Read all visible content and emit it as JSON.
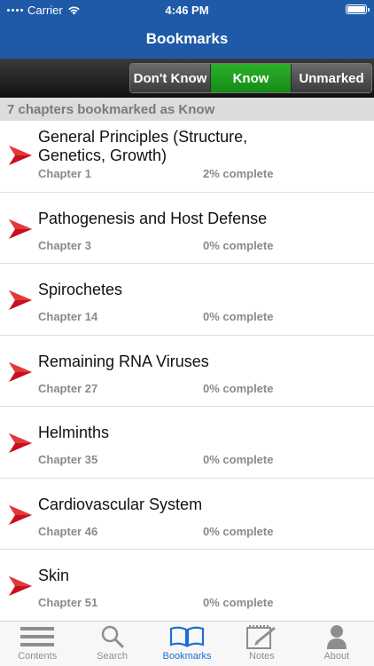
{
  "status_bar": {
    "carrier": "Carrier",
    "time": "4:46 PM"
  },
  "nav": {
    "title": "Bookmarks"
  },
  "filter": {
    "options": [
      "Don't Know",
      "Know",
      "Unmarked"
    ],
    "selected": "Know",
    "selected_color": "#1f9f1f"
  },
  "section_header": "7 chapters bookmarked as Know",
  "chapters": [
    {
      "title": "General Principles (Structure, Genetics, Growth)",
      "chapter": "Chapter 1",
      "progress": "2% complete"
    },
    {
      "title": "Pathogenesis and Host Defense",
      "chapter": "Chapter 3",
      "progress": "0% complete"
    },
    {
      "title": "Spirochetes",
      "chapter": "Chapter 14",
      "progress": "0% complete"
    },
    {
      "title": "Remaining RNA Viruses",
      "chapter": "Chapter 27",
      "progress": "0% complete"
    },
    {
      "title": "Helminths",
      "chapter": "Chapter 35",
      "progress": "0% complete"
    },
    {
      "title": "Cardiovascular System",
      "chapter": "Chapter 46",
      "progress": "0% complete"
    },
    {
      "title": "Skin",
      "chapter": "Chapter 51",
      "progress": "0% complete"
    }
  ],
  "tabs": [
    {
      "label": "Contents",
      "icon": "list-icon"
    },
    {
      "label": "Search",
      "icon": "search-icon"
    },
    {
      "label": "Bookmarks",
      "icon": "book-icon",
      "active": true
    },
    {
      "label": "Notes",
      "icon": "notepad-icon"
    },
    {
      "label": "About",
      "icon": "person-icon"
    }
  ],
  "colors": {
    "nav_blue": "#1f5aa8",
    "arrow_red": "#c8101e",
    "tab_active": "#1a6fd6"
  }
}
